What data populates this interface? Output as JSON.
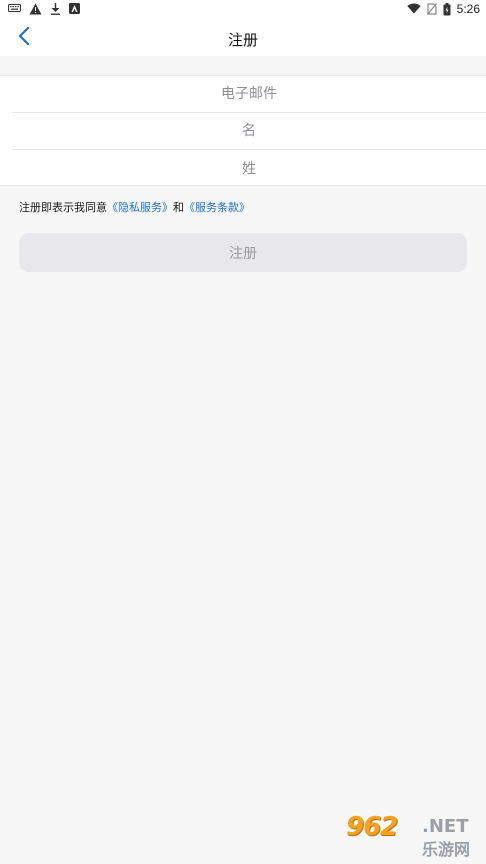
{
  "status_bar": {
    "time": "5:26",
    "left_icons": [
      "keyboard-icon",
      "warning-icon",
      "download-icon",
      "app-notification-icon"
    ],
    "right_icons": [
      "wifi-icon",
      "no-sim-icon",
      "battery-icon"
    ]
  },
  "nav": {
    "title": "注册",
    "back_icon": "chevron-left-icon",
    "accent_color": "#1f6fd1"
  },
  "form": {
    "email_placeholder": "电子邮件",
    "first_name_placeholder": "名",
    "last_name_placeholder": "姓",
    "email_value": "",
    "first_name_value": "",
    "last_name_value": ""
  },
  "agreement": {
    "prefix": "注册即表示我同意",
    "privacy_link": "《隐私服务》",
    "conjunction": "和",
    "terms_link": "《服务条款》"
  },
  "submit": {
    "label": "注册"
  },
  "watermark": {
    "number": "962",
    "suffix": ".NET",
    "site": "乐游网"
  }
}
